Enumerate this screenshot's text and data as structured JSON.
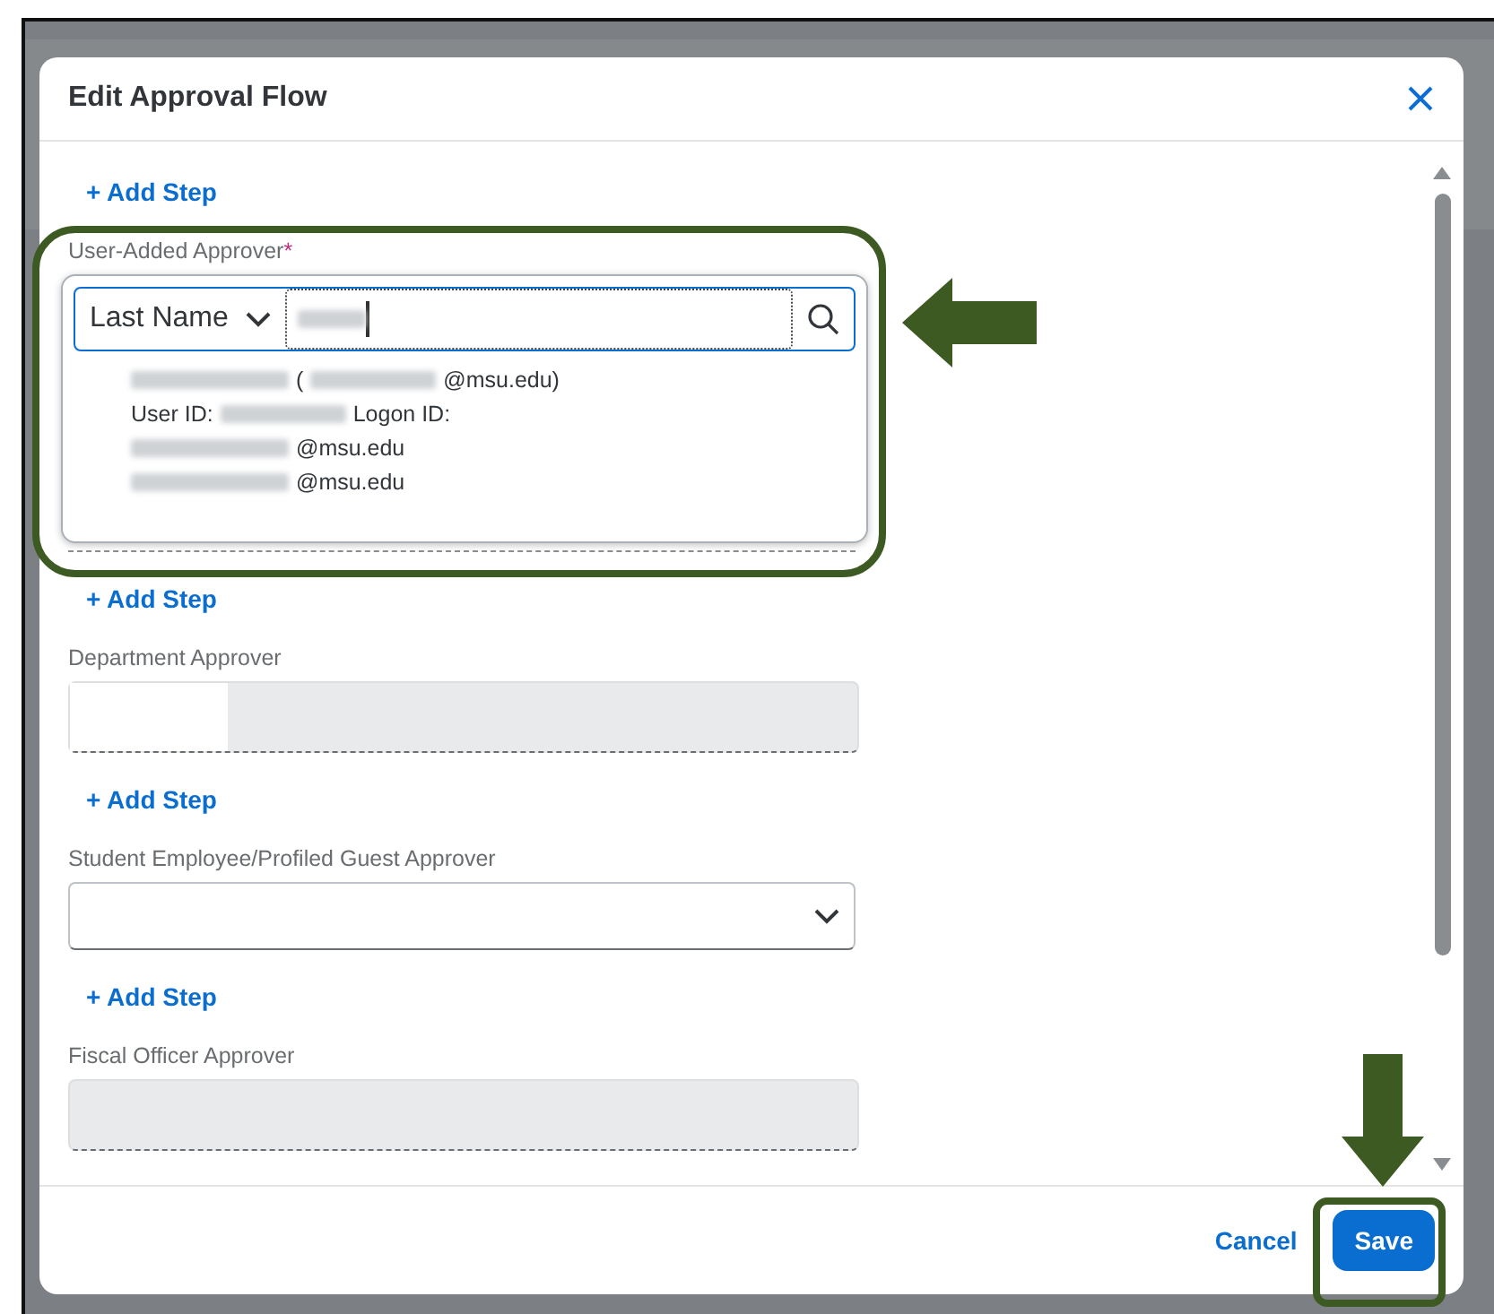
{
  "dialog": {
    "title": "Edit Approval Flow"
  },
  "top_add_step": "+ Add Step",
  "approvers": [
    {
      "kind": "search",
      "label": "User-Added Approver",
      "required_mark": "*",
      "filter": "Last Name",
      "add_step": "+ Add Step",
      "result_lines": [
        [
          {
            "kind": "redacted"
          },
          {
            "kind": "text",
            "text": "("
          },
          {
            "kind": "redacted"
          },
          {
            "kind": "text",
            "text": "@msu.edu)"
          }
        ],
        [
          {
            "kind": "text",
            "text": "User ID:"
          },
          {
            "kind": "redacted"
          },
          {
            "kind": "text",
            "text": "Logon ID:"
          }
        ],
        [
          {
            "kind": "redacted"
          },
          {
            "kind": "text",
            "text": "@msu.edu"
          }
        ],
        [
          {
            "kind": "redacted"
          },
          {
            "kind": "text",
            "text": "@msu.edu"
          }
        ]
      ]
    },
    {
      "kind": "readonly",
      "label": "Department Approver",
      "add_step": "+ Add Step"
    },
    {
      "kind": "select",
      "label": "Student Employee/Profiled Guest Approver",
      "add_step": "+ Add Step"
    },
    {
      "kind": "readonly",
      "label": "Fiscal Officer Approver"
    }
  ],
  "footer": {
    "cancel": "Cancel",
    "save": "Save"
  }
}
